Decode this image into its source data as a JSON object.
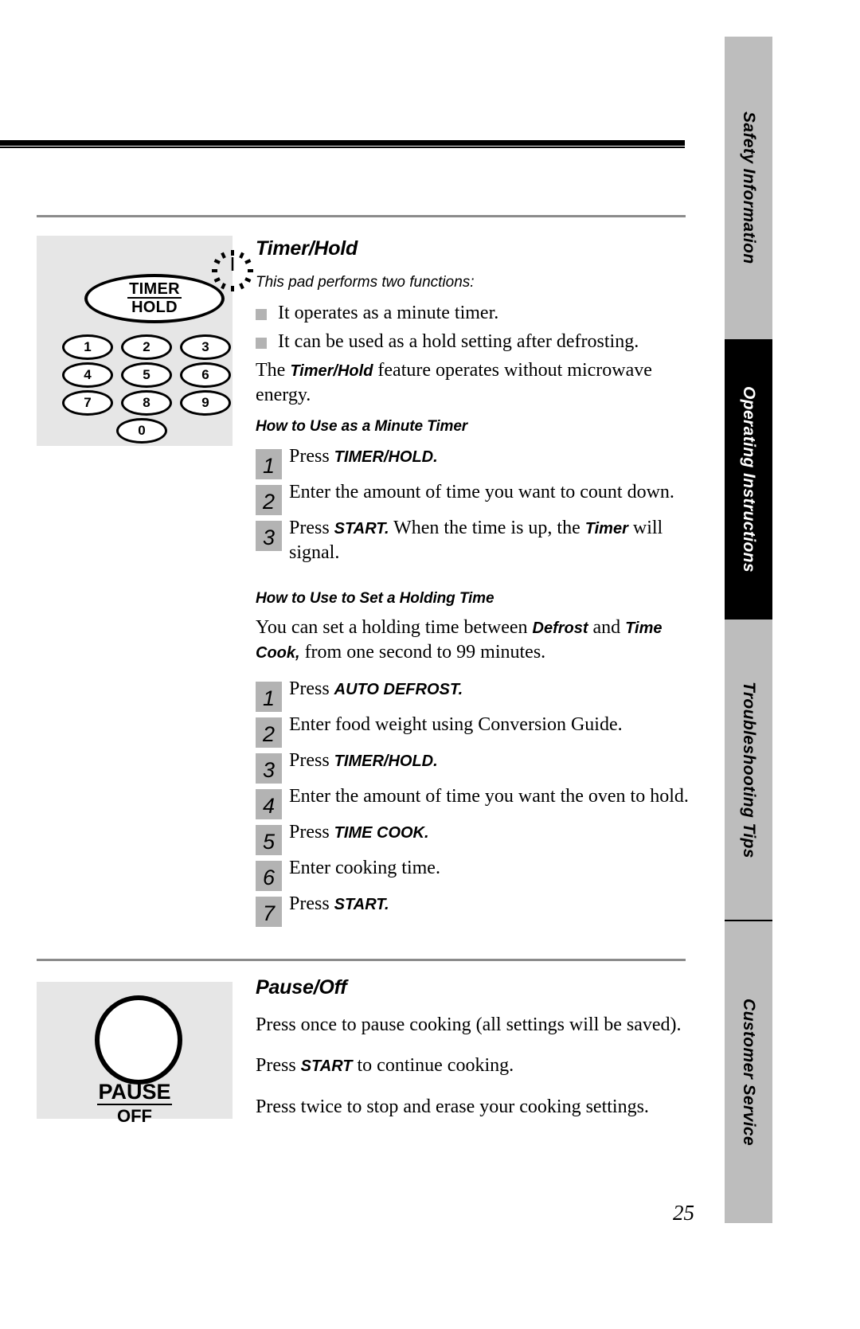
{
  "page": {
    "number": "25"
  },
  "sidebar": {
    "tabs": [
      {
        "label": "Safety Information",
        "active": false
      },
      {
        "label": "Operating Instructions",
        "active": true
      },
      {
        "label": "Troubleshooting Tips",
        "active": false
      },
      {
        "label": "Customer Service",
        "active": false
      }
    ]
  },
  "keypad": {
    "timer_button": {
      "line1": "TIMER",
      "line2": "HOLD"
    },
    "icon": "clock-starburst-icon",
    "keys": [
      "1",
      "2",
      "3",
      "4",
      "5",
      "6",
      "7",
      "8",
      "9",
      "0"
    ]
  },
  "pause_panel": {
    "button_label_line1": "PAUSE",
    "button_label_line2": "OFF"
  },
  "timer_hold": {
    "heading": "Timer/Hold",
    "intro": "This pad performs two functions:",
    "bullets": [
      "It operates as a minute timer.",
      "It can be used as a hold setting after defrosting."
    ],
    "paragraph_pre": "The ",
    "paragraph_bold": "Timer/Hold",
    "paragraph_post": " feature operates without microwave energy.",
    "minute_timer": {
      "heading": "How to Use as a Minute Timer",
      "steps": [
        {
          "num": "1",
          "pre": "Press ",
          "bold": "TIMER/HOLD.",
          "post": ""
        },
        {
          "num": "2",
          "pre": "Enter the amount of time you want to count down.",
          "bold": "",
          "post": ""
        },
        {
          "num": "3",
          "pre": "Press ",
          "bold": "START.",
          "post": " When the time is up, the ",
          "bold2": "Timer",
          "post2": " will signal."
        }
      ]
    },
    "holding_time": {
      "heading": "How to Use to Set a Holding Time",
      "paragraph_pre": "You can set a holding time between ",
      "paragraph_bold1": "Defrost",
      "paragraph_mid": " and ",
      "paragraph_bold2": "Time Cook,",
      "paragraph_post": " from one second to 99 minutes.",
      "steps": [
        {
          "num": "1",
          "pre": "Press ",
          "bold": "AUTO DEFROST.",
          "post": ""
        },
        {
          "num": "2",
          "pre": "Enter food weight using Conversion Guide.",
          "bold": "",
          "post": ""
        },
        {
          "num": "3",
          "pre": "Press ",
          "bold": "TIMER/HOLD.",
          "post": ""
        },
        {
          "num": "4",
          "pre": "Enter the amount of time you want the oven to hold.",
          "bold": "",
          "post": ""
        },
        {
          "num": "5",
          "pre": "Press ",
          "bold": "TIME COOK.",
          "post": ""
        },
        {
          "num": "6",
          "pre": "Enter cooking time.",
          "bold": "",
          "post": ""
        },
        {
          "num": "7",
          "pre": "Press ",
          "bold": "START.",
          "post": ""
        }
      ]
    }
  },
  "pause_off": {
    "heading": "Pause/Off",
    "line1": "Press once to pause cooking (all settings will be saved).",
    "line2_pre": "Press ",
    "line2_bold": "START",
    "line2_post": " to continue cooking.",
    "line3": "Press twice to stop and erase your cooking settings."
  }
}
